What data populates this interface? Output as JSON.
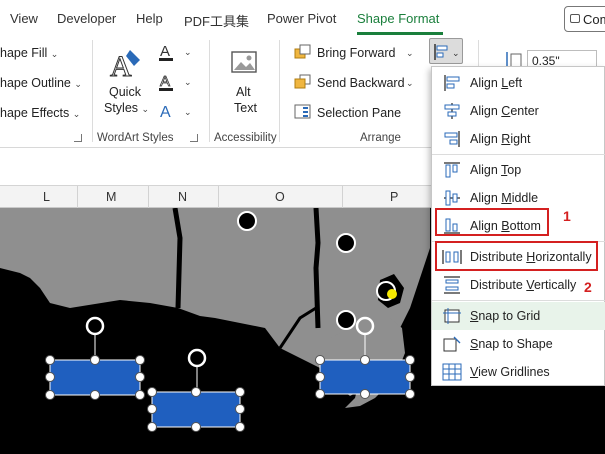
{
  "tabs": [
    {
      "label": "View",
      "active": false
    },
    {
      "label": "Developer",
      "active": false
    },
    {
      "label": "Help",
      "active": false
    },
    {
      "label": "PDF工具集",
      "active": false
    },
    {
      "label": "Power Pivot",
      "active": false
    },
    {
      "label": "Shape Format",
      "active": true
    }
  ],
  "comments_label": "Com",
  "ribbon": {
    "shape_styles": {
      "fill": "hape Fill",
      "outline": "hape Outline",
      "effects": "hape Effects"
    },
    "wordart": {
      "quick_styles": "Quick",
      "quick_styles_2": "Styles",
      "group_label": "WordArt Styles"
    },
    "accessibility": {
      "alt_text": "Alt",
      "alt_text_2": "Text",
      "group_label": "Accessibility"
    },
    "arrange": {
      "bring_forward": "Bring Forward",
      "send_backward": "Send Backward",
      "selection_pane": "Selection Pane",
      "group_label": "Arrange"
    },
    "size": {
      "height": "0.35\""
    }
  },
  "columns": [
    "L",
    "M",
    "N",
    "O",
    "P"
  ],
  "menu": {
    "items": [
      {
        "label_pre": "Align ",
        "label_u": "L",
        "label_post": "eft",
        "icon": "align-left-icon"
      },
      {
        "label_pre": "Align ",
        "label_u": "C",
        "label_post": "enter",
        "icon": "align-center-icon"
      },
      {
        "label_pre": "Align ",
        "label_u": "R",
        "label_post": "ight",
        "icon": "align-right-icon"
      },
      {
        "label_pre": "Align ",
        "label_u": "T",
        "label_post": "op",
        "icon": "align-top-icon"
      },
      {
        "label_pre": "Align ",
        "label_u": "M",
        "label_post": "iddle",
        "icon": "align-middle-icon"
      },
      {
        "label_pre": "Align ",
        "label_u": "B",
        "label_post": "ottom",
        "icon": "align-bottom-icon"
      },
      {
        "label_pre": "Distribute ",
        "label_u": "H",
        "label_post": "orizontally",
        "icon": "distribute-horizontal-icon"
      },
      {
        "label_pre": "Distribute ",
        "label_u": "V",
        "label_post": "ertically",
        "icon": "distribute-vertical-icon"
      },
      {
        "label_pre": "",
        "label_u": "S",
        "label_post": "nap to Grid",
        "icon": "snap-grid-icon"
      },
      {
        "label_pre": "",
        "label_u": "S",
        "label_post": "nap to Shape",
        "icon": "snap-shape-icon"
      },
      {
        "label_pre": "",
        "label_u": "V",
        "label_post": "iew Gridlines",
        "icon": "gridlines-icon"
      }
    ]
  },
  "annotations": {
    "first": "1",
    "second": "2"
  },
  "colors": {
    "accent": "#1a7f3c",
    "annotation": "#d42020",
    "shape_fill": "#1f5fbf"
  }
}
